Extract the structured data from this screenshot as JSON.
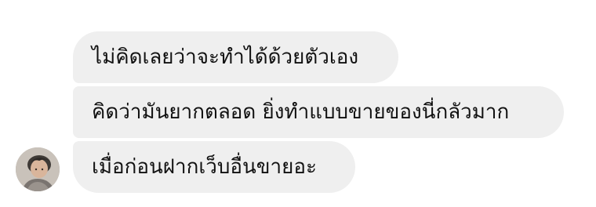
{
  "conversation": {
    "messages": [
      {
        "text": "ไม่คิดเลยว่าจะทำได้ด้วยตัวเอง"
      },
      {
        "text": "คิดว่ามันยากตลอด ยิ่งทำแบบขายของนี่กลัวมาก"
      },
      {
        "text": "เมื่อก่อนฝากเว็บอื่นขายอะ"
      }
    ],
    "sender": {
      "avatar_icon": "user-photo-icon"
    }
  },
  "colors": {
    "bubble_background": "#efefef",
    "text": "#111111",
    "page_background": "#ffffff"
  }
}
